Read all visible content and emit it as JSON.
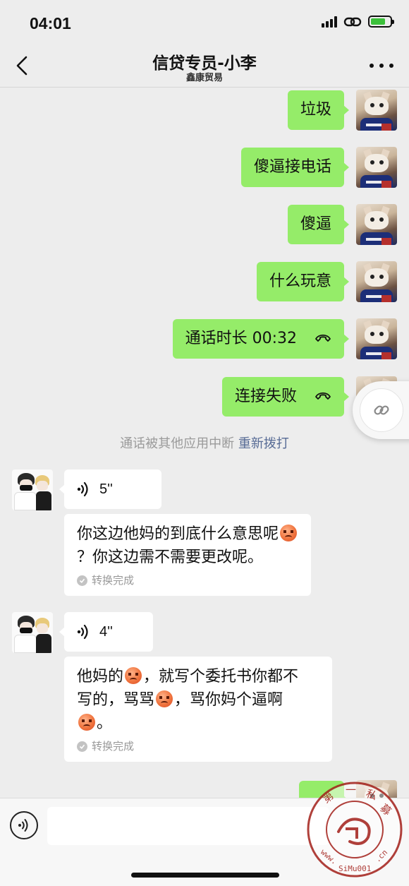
{
  "status_bar": {
    "time": "04:01"
  },
  "header": {
    "title": "信贷专员-小李",
    "subtitle": "鑫康贸易"
  },
  "messages_out": [
    {
      "text": "垃圾"
    },
    {
      "text": "傻逼接电话"
    },
    {
      "text": "傻逼"
    },
    {
      "text": "什么玩意"
    },
    {
      "text": "通话时长 00:32",
      "icon": "hangup-icon"
    },
    {
      "text": "连接失败",
      "icon": "hangup-icon"
    }
  ],
  "system": {
    "notice": "通话被其他应用中断",
    "redial": "重新拨打"
  },
  "voice_messages": [
    {
      "duration": "5''",
      "transcript_a": "你这边他妈的到底什么意思呢",
      "transcript_b": "？你这边需不需要更改呢。",
      "status": "转换完成"
    },
    {
      "duration": "4''",
      "transcript_a": "他妈的",
      "transcript_b": "，就写个委托书你都不",
      "transcript_c": "写的，骂骂",
      "transcript_d": "，骂你妈个逼啊",
      "transcript_e": "。",
      "status": "转换完成"
    }
  ],
  "watermark": {
    "text": "第一私募 www.SiMu001.cn"
  },
  "colors": {
    "outgoing_bubble": "#95ec69",
    "incoming_bubble": "#ffffff",
    "background": "#ededed",
    "link": "#576b95"
  }
}
